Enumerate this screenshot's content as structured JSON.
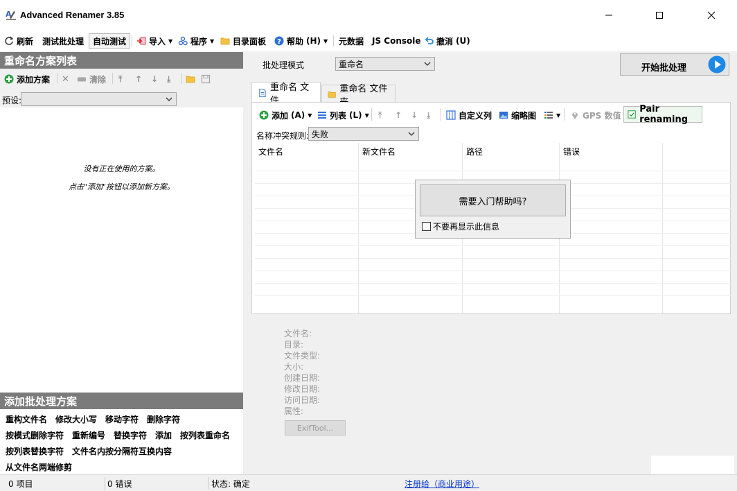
{
  "window": {
    "title": "Advanced Renamer 3.85"
  },
  "toolbar": {
    "refresh": "刷新",
    "test_batch": "测试批处理",
    "auto_test": "自动测试",
    "import": "导入",
    "program": "程序",
    "dir_panel": "目录面板",
    "help": "帮助",
    "help_key": "(H)",
    "metadata": "元数据",
    "js_console": "JS Console",
    "undo": "撤消",
    "undo_key": "(U)"
  },
  "left_panel": {
    "header": "重命名方案列表",
    "add_method": "添加方案",
    "clear": "清除",
    "preset_label": "预设:",
    "preset_value": "",
    "empty_line1": "没有正在使用的方案。",
    "empty_line2": "点击\"添加\"按钮以添加新方案。"
  },
  "add_methods": {
    "header": "添加批处理方案",
    "items": [
      "重构文件名",
      "修改大小写",
      "移动字符",
      "删除字符",
      "按模式删除字符",
      "重新编号",
      "替换字符",
      "添加",
      "按列表重命名",
      "按列表替换字符",
      "文件名内按分隔符互换内容",
      "从文件名两端修剪"
    ]
  },
  "batch": {
    "mode_label": "批处理模式",
    "mode_value": "重命名",
    "start_label": "开始批处理"
  },
  "tabs": [
    {
      "label": "重命名 文件",
      "active": true
    },
    {
      "label": "重命名 文件夹",
      "active": false
    }
  ],
  "file_toolbar": {
    "add": "添加",
    "add_key": "(A)",
    "list": "列表",
    "list_key": "(L)",
    "custom_columns": "自定义列",
    "thumbnails": "缩略图",
    "gps": "GPS 数值",
    "pair": "Pair renaming"
  },
  "conflict": {
    "label": "名称冲突规则:",
    "value": "失败"
  },
  "grid": {
    "columns": [
      "文件名",
      "新文件名",
      "路径",
      "错误"
    ]
  },
  "popup": {
    "button": "需要入门帮助吗?",
    "checkbox_label": "不要再显示此信息"
  },
  "info": {
    "labels": [
      "文件名:",
      "目录:",
      "文件类型:",
      "大小:",
      "创建日期:",
      "修改日期:",
      "访问日期:",
      "属性:"
    ],
    "exif_button": "ExifTool..."
  },
  "status": {
    "items": "0 项目",
    "errors": "0 错误",
    "state": "状态: 确定",
    "register": "注册给（商业用途）"
  },
  "colors": {
    "header_bg": "#7b7b7b",
    "accent_blue": "#1e88e5",
    "add_green": "#2e9e44"
  }
}
